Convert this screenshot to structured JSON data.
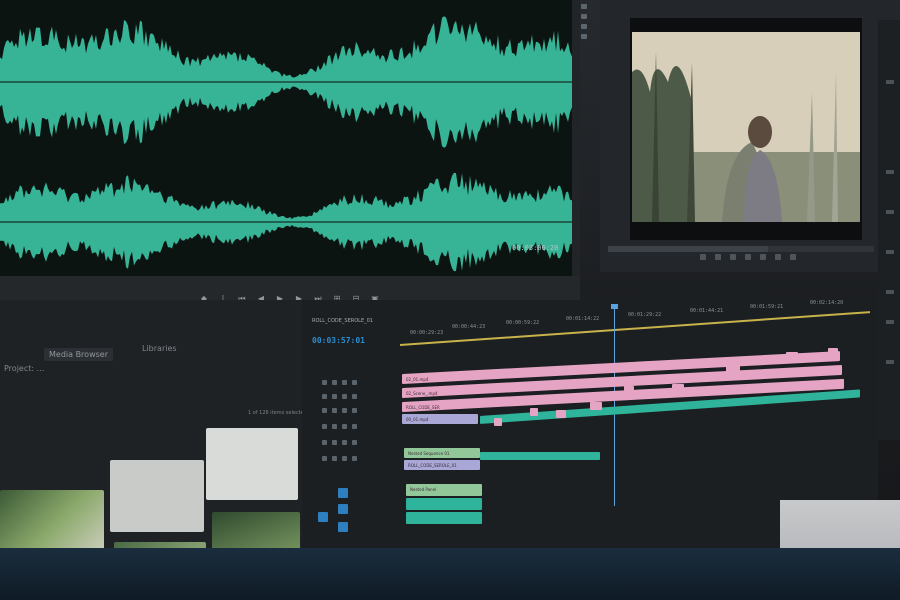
{
  "source_monitor": {
    "timecode": "00:03:06:20"
  },
  "program_monitor": {
    "scrub_progress": 0.6
  },
  "transport": {
    "buttons": [
      "mark-in",
      "mark-out",
      "go-to-in",
      "step-back",
      "play",
      "step-forward",
      "go-to-out",
      "insert",
      "overwrite",
      "export-frame"
    ]
  },
  "project_panel": {
    "tabs": [
      "Project: ...",
      "Media Browser",
      "Libraries"
    ],
    "item_count": "1 of 126 items selected"
  },
  "timeline": {
    "sequence_tab": "ROLL_CODE_SEROLE_01",
    "timecode": "00:03:57:01",
    "ruler_labels": [
      "00:00:29:23",
      "00:00:44:23",
      "00:00:59:22",
      "00:01:14:22",
      "00:01:29:22",
      "00:01:44:21",
      "00:01:59:21",
      "00:02:14:20"
    ],
    "clips": {
      "v3": "02_01.mp4",
      "v2": "02_Scene_.mp4",
      "v1": "ROLL_CODE_SER",
      "v1b": "00_01.mp4",
      "a1": "Nested Sequence 01",
      "a2": "ROLL_CODE_SEROLE_01",
      "a3": "Nested Panel"
    }
  },
  "colors": {
    "waveform": "#3fcfae",
    "clip_pink": "#e5a4c4",
    "clip_teal": "#2fb39a",
    "clip_green": "#92c79a",
    "timecode_blue": "#2d8ccf",
    "playhead": "#5aa2e0"
  }
}
